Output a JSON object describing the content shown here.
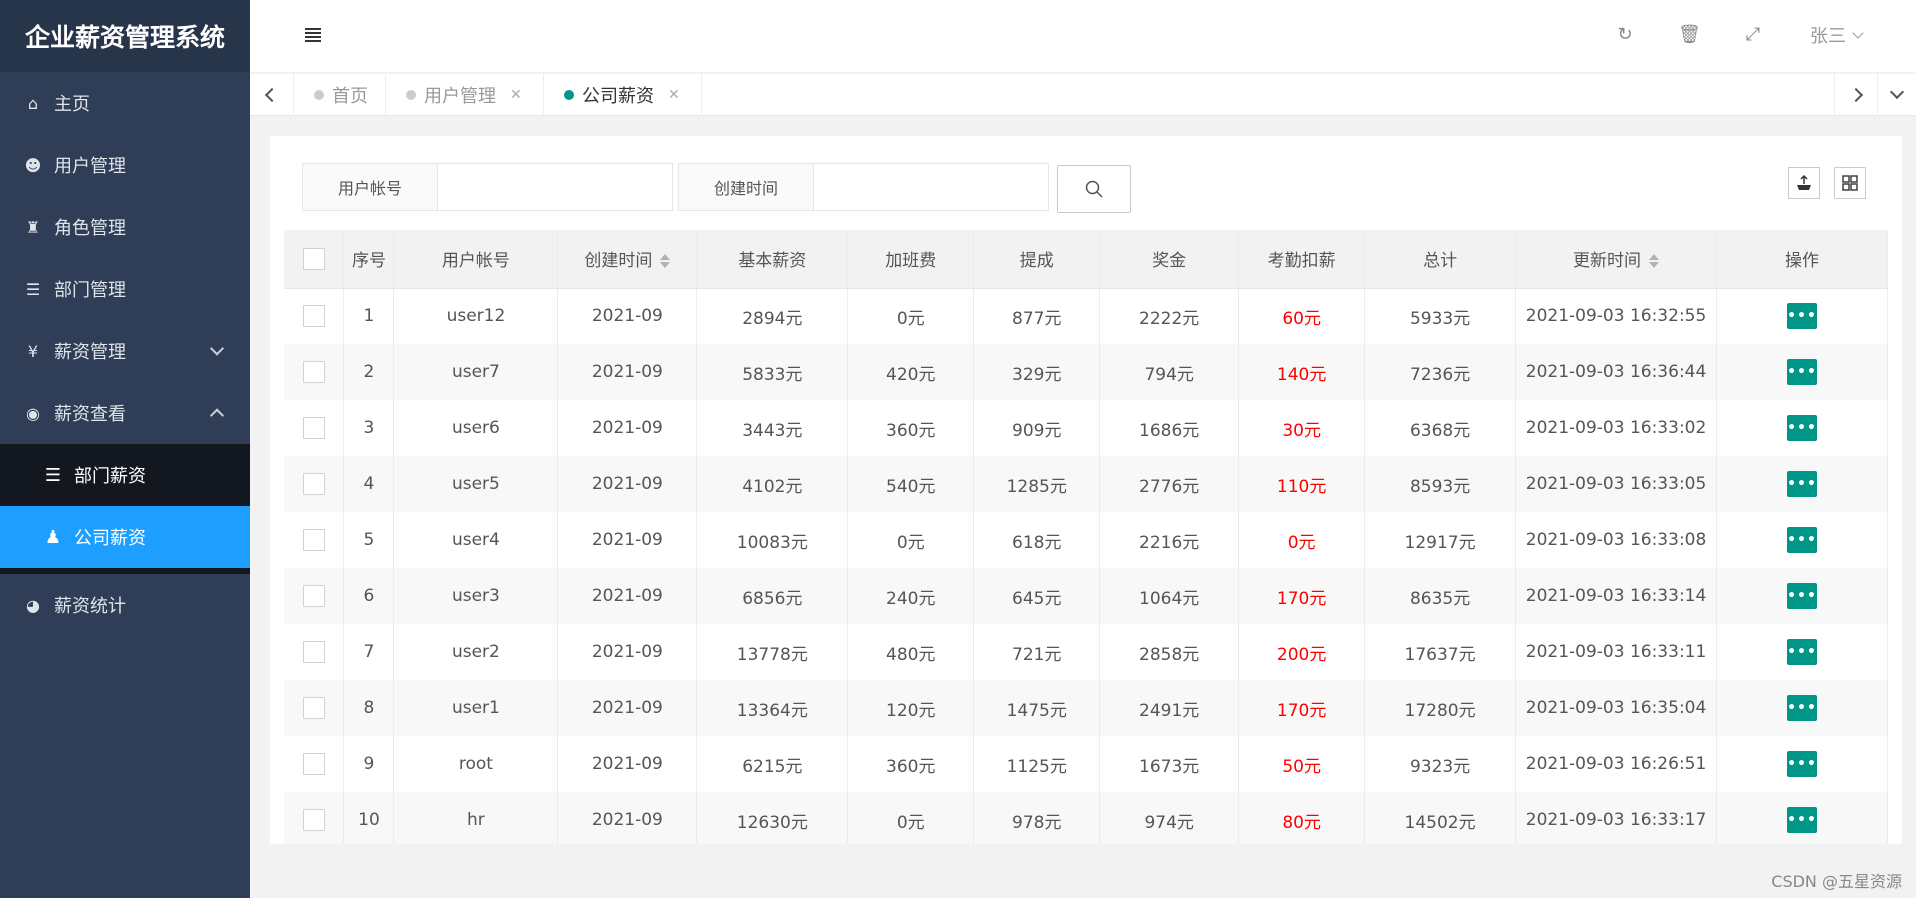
{
  "app": {
    "title": "企业薪资管理系统"
  },
  "sidebar": {
    "items": [
      {
        "label": "主页",
        "icon": "home-icon"
      },
      {
        "label": "用户管理",
        "icon": "user-icon"
      },
      {
        "label": "角色管理",
        "icon": "role-icon"
      },
      {
        "label": "部门管理",
        "icon": "list-icon"
      },
      {
        "label": "薪资管理",
        "icon": "yen-icon"
      },
      {
        "label": "薪资查看",
        "icon": "eye-icon"
      },
      {
        "label": "薪资统计",
        "icon": "pie-chart-icon"
      }
    ],
    "submenu": [
      {
        "label": "部门薪资",
        "icon": "list-icon"
      },
      {
        "label": "公司薪资",
        "icon": "group-icon"
      }
    ]
  },
  "header": {
    "user": "张三"
  },
  "tabs": [
    {
      "label": "首页"
    },
    {
      "label": "用户管理"
    },
    {
      "label": "公司薪资"
    }
  ],
  "search": {
    "account_label": "用户帐号",
    "account_value": "",
    "time_label": "创建时间",
    "time_value": ""
  },
  "table": {
    "headers": [
      "序号",
      "用户帐号",
      "创建时间",
      "基本薪资",
      "加班费",
      "提成",
      "奖金",
      "考勤扣薪",
      "总计",
      "更新时间",
      "操作"
    ],
    "rows": [
      [
        "1",
        "user12",
        "2021-09",
        "2894元",
        "0元",
        "877元",
        "2222元",
        "60元",
        "5933元",
        "2021-09-03 16:32:55"
      ],
      [
        "2",
        "user7",
        "2021-09",
        "5833元",
        "420元",
        "329元",
        "794元",
        "140元",
        "7236元",
        "2021-09-03 16:36:44"
      ],
      [
        "3",
        "user6",
        "2021-09",
        "3443元",
        "360元",
        "909元",
        "1686元",
        "30元",
        "6368元",
        "2021-09-03 16:33:02"
      ],
      [
        "4",
        "user5",
        "2021-09",
        "4102元",
        "540元",
        "1285元",
        "2776元",
        "110元",
        "8593元",
        "2021-09-03 16:33:05"
      ],
      [
        "5",
        "user4",
        "2021-09",
        "10083元",
        "0元",
        "618元",
        "2216元",
        "0元",
        "12917元",
        "2021-09-03 16:33:08"
      ],
      [
        "6",
        "user3",
        "2021-09",
        "6856元",
        "240元",
        "645元",
        "1064元",
        "170元",
        "8635元",
        "2021-09-03 16:33:14"
      ],
      [
        "7",
        "user2",
        "2021-09",
        "13778元",
        "480元",
        "721元",
        "2858元",
        "200元",
        "17637元",
        "2021-09-03 16:33:11"
      ],
      [
        "8",
        "user1",
        "2021-09",
        "13364元",
        "120元",
        "1475元",
        "2491元",
        "170元",
        "17280元",
        "2021-09-03 16:35:04"
      ],
      [
        "9",
        "root",
        "2021-09",
        "6215元",
        "360元",
        "1125元",
        "1673元",
        "50元",
        "9323元",
        "2021-09-03 16:26:51"
      ],
      [
        "10",
        "hr",
        "2021-09",
        "12630元",
        "0元",
        "978元",
        "974元",
        "80元",
        "14502元",
        "2021-09-03 16:33:17"
      ]
    ]
  },
  "watermark": "CSDN @五星资源",
  "colors": {
    "sidebar": "#2f3e56",
    "active": "#1e9fff",
    "accent": "#009688",
    "deduct": "#ff0000"
  }
}
